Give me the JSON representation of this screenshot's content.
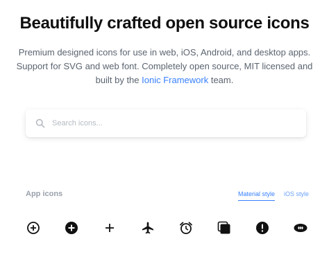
{
  "hero": {
    "title": "Beautifully crafted open source icons",
    "desc_line1": "Premium designed icons for use in web, iOS, Android, and desktop apps.",
    "desc_line2": "Support for SVG and web font. Completely open source, MIT licensed and",
    "desc_line3_pre": "built by the ",
    "desc_link": "Ionic Framework",
    "desc_line3_post": " team."
  },
  "search": {
    "placeholder": "Search icons...",
    "icon": "search-icon"
  },
  "icons_section": {
    "title": "App icons",
    "tabs": [
      {
        "label": "Material style",
        "active": true
      },
      {
        "label": "iOS style",
        "active": false
      }
    ],
    "icons": [
      "add-circle-outline-icon",
      "add-circle-icon",
      "add-icon",
      "airplane-icon",
      "alarm-icon",
      "albums-icon",
      "alert-circle-icon",
      "american-football-icon"
    ]
  },
  "colors": {
    "accent": "#3880ff",
    "text": "#0f0f10",
    "muted": "#5b6470"
  }
}
